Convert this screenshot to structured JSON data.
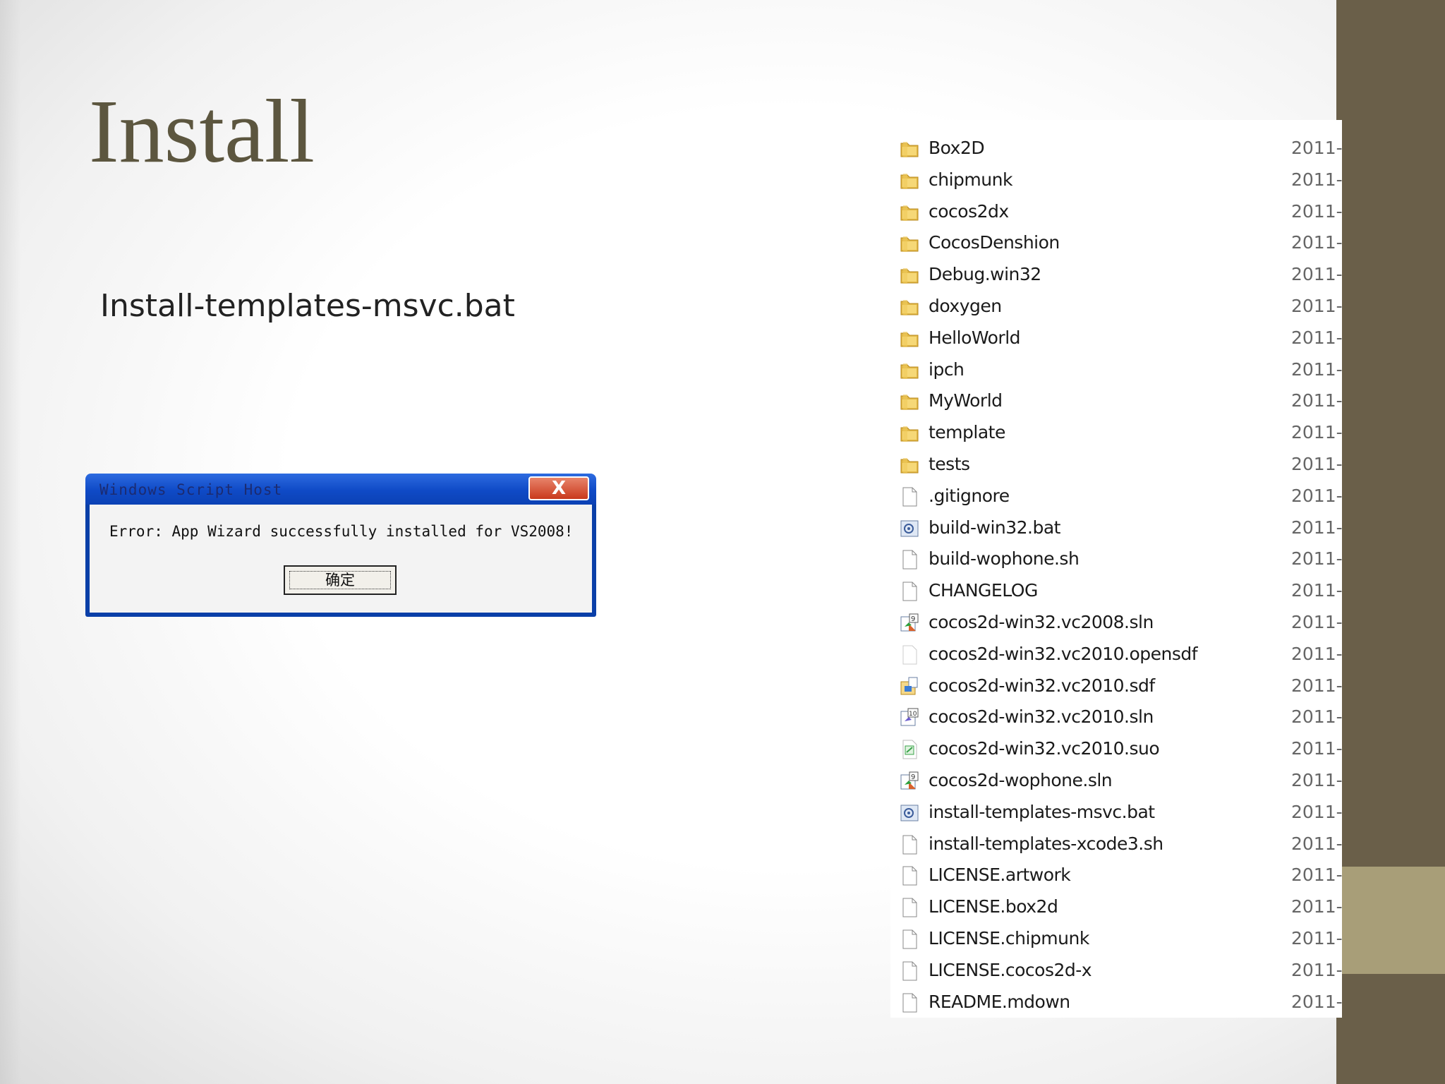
{
  "slide": {
    "title": "Install",
    "subtitle": "Install-templates-msvc.bat"
  },
  "colors": {
    "title": "#5c563f",
    "side_bar": "#6a5f49",
    "side_accent": "#a89e78",
    "dialog_titlebar": "#0f4ac6",
    "dialog_close": "#c9391c"
  },
  "dialog": {
    "title": "Windows Script Host",
    "close_label": "X",
    "message": "Error: App Wizard successfully installed for VS2008!",
    "ok_label": "确定"
  },
  "explorer": {
    "files": [
      {
        "name": "Box2D",
        "date": "2011-",
        "icon": "folder-icon"
      },
      {
        "name": "chipmunk",
        "date": "2011-",
        "icon": "folder-icon"
      },
      {
        "name": "cocos2dx",
        "date": "2011-",
        "icon": "folder-icon"
      },
      {
        "name": "CocosDenshion",
        "date": "2011-",
        "icon": "folder-icon"
      },
      {
        "name": "Debug.win32",
        "date": "2011-",
        "icon": "folder-icon"
      },
      {
        "name": "doxygen",
        "date": "2011-",
        "icon": "folder-icon"
      },
      {
        "name": "HelloWorld",
        "date": "2011-",
        "icon": "folder-icon"
      },
      {
        "name": "ipch",
        "date": "2011-",
        "icon": "folder-icon"
      },
      {
        "name": "MyWorld",
        "date": "2011-",
        "icon": "folder-icon"
      },
      {
        "name": "template",
        "date": "2011-",
        "icon": "folder-icon"
      },
      {
        "name": "tests",
        "date": "2011-",
        "icon": "folder-icon"
      },
      {
        "name": ".gitignore",
        "date": "2011-",
        "icon": "file-icon"
      },
      {
        "name": "build-win32.bat",
        "date": "2011-",
        "icon": "batch-file-icon"
      },
      {
        "name": "build-wophone.sh",
        "date": "2011-",
        "icon": "file-icon"
      },
      {
        "name": "CHANGELOG",
        "date": "2011-",
        "icon": "file-icon"
      },
      {
        "name": "cocos2d-win32.vc2008.sln",
        "date": "2011-",
        "icon": "vs2008-solution-icon"
      },
      {
        "name": "cocos2d-win32.vc2010.opensdf",
        "date": "2011-",
        "icon": "blank-file-icon"
      },
      {
        "name": "cocos2d-win32.vc2010.sdf",
        "date": "2011-",
        "icon": "database-file-icon"
      },
      {
        "name": "cocos2d-win32.vc2010.sln",
        "date": "2011-",
        "icon": "vs2010-solution-icon"
      },
      {
        "name": "cocos2d-win32.vc2010.suo",
        "date": "2011-",
        "icon": "suo-file-icon"
      },
      {
        "name": "cocos2d-wophone.sln",
        "date": "2011-",
        "icon": "vs2008-solution-icon"
      },
      {
        "name": "install-templates-msvc.bat",
        "date": "2011-",
        "icon": "batch-file-icon"
      },
      {
        "name": "install-templates-xcode3.sh",
        "date": "2011-",
        "icon": "file-icon"
      },
      {
        "name": "LICENSE.artwork",
        "date": "2011-",
        "icon": "file-icon"
      },
      {
        "name": "LICENSE.box2d",
        "date": "2011-",
        "icon": "file-icon"
      },
      {
        "name": "LICENSE.chipmunk",
        "date": "2011-",
        "icon": "file-icon"
      },
      {
        "name": "LICENSE.cocos2d-x",
        "date": "2011-",
        "icon": "file-icon"
      },
      {
        "name": "README.mdown",
        "date": "2011-",
        "icon": "file-icon"
      }
    ]
  }
}
